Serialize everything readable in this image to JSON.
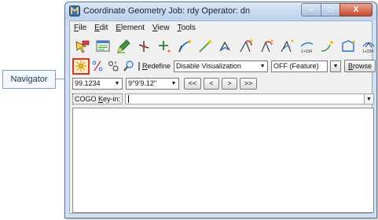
{
  "callout": {
    "label": "Navigator"
  },
  "window": {
    "title": "Coordinate Geometry  Job: rdy  Operator: dn",
    "controls": {
      "minimize": "–",
      "maximize": "□",
      "close": "X"
    }
  },
  "menu": [
    {
      "mnemonic": "F",
      "rest": "ile"
    },
    {
      "mnemonic": "E",
      "rest": "dit"
    },
    {
      "mnemonic": "E",
      "rest": "lement"
    },
    {
      "mnemonic": "V",
      "rest": "iew"
    },
    {
      "mnemonic": "T",
      "rest": "ools"
    }
  ],
  "toolbar1": {
    "icons": [
      "select-element-icon",
      "list-dialog-icon",
      "edit-pencil-icon",
      "store-point-icon",
      "add-point-icon",
      "curve-arc-icon",
      "line-point-icon",
      "arc-point-icon",
      "curve-tangent-icon",
      "arc-tangent-icon",
      "curve-offset-icon",
      "spiral-station-icon",
      "spiral-icon",
      "polygon-icon",
      "station-offset-icon",
      "forward-arrow-icon"
    ],
    "station_label": "1+234"
  },
  "toolbar2": {
    "navigator_icon": "navigator-icon",
    "icons": [
      "percent-tool-icon",
      "locate-cogo-icon",
      "magnifier-icon"
    ],
    "redefine": {
      "mnemonic": "R",
      "rest": "edefine",
      "checked": false
    },
    "visualization_select": "Disable Visualization",
    "feature_select": "OFF (Feature)",
    "browse": {
      "mnemonic": "B",
      "rest": "rowse"
    }
  },
  "row3": {
    "coordinate_value": "99.1234",
    "angle_value": "9°9'9.12\"",
    "nav_buttons": [
      "<<",
      "<",
      ">",
      ">>"
    ]
  },
  "keyin": {
    "mnemonic": "K",
    "pre": "COGO ",
    "post": "ey-in:",
    "value": ""
  },
  "colors": {
    "callout_border": "#7fa0c4",
    "navigator_highlight": "#e0302a",
    "titlebar": "#cfe0f2"
  }
}
